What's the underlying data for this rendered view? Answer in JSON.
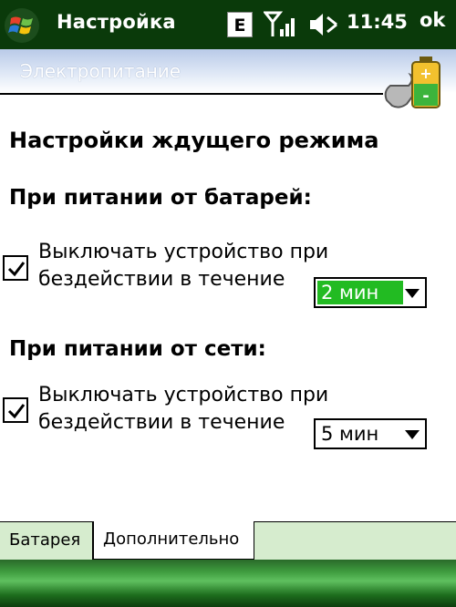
{
  "titlebar": {
    "title": "Настройка",
    "network_type": "E",
    "clock": "11:45",
    "ok_label": "ok"
  },
  "section": {
    "title": "Электропитание"
  },
  "content": {
    "heading": "Настройки ждущего режима",
    "battery": {
      "heading": "При питании от батарей:",
      "checkbox_checked": true,
      "label_line1": "Выключать устройство при",
      "label_line2": "бездействии в течение",
      "selected": "2 мин"
    },
    "ac": {
      "heading": "При питании от сети:",
      "checkbox_checked": true,
      "label_line1": "Выключать устройство при",
      "label_line2": "бездействии в течение",
      "selected": "5 мин"
    }
  },
  "tabs": [
    {
      "label": "Батарея",
      "active": false
    },
    {
      "label": "Дополнительно",
      "active": true
    }
  ],
  "colors": {
    "titlebar_bg": "#0a3a0a",
    "selection_green": "#22bb22",
    "tabbar_bg": "#d6ecce"
  },
  "icons": [
    "windows-flag-icon",
    "signal-strength-icon",
    "speaker-icon",
    "battery-power-icon",
    "checkmark-icon",
    "dropdown-arrow-icon"
  ]
}
